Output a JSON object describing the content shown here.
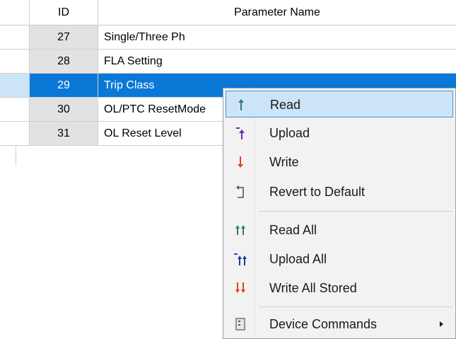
{
  "grid": {
    "columns": {
      "id": "ID",
      "name": "Parameter Name"
    },
    "rows": [
      {
        "id": "27",
        "name": "Single/Three Ph"
      },
      {
        "id": "28",
        "name": "FLA Setting"
      },
      {
        "id": "29",
        "name": "Trip Class",
        "selected": true
      },
      {
        "id": "30",
        "name": "OL/PTC ResetMode"
      },
      {
        "id": "31",
        "name": "OL Reset Level"
      }
    ]
  },
  "context_menu": {
    "items": [
      {
        "label": "Read",
        "icon": "read-arrow-up-icon",
        "highlighted": true
      },
      {
        "label": "Upload",
        "icon": "upload-arrow-icon"
      },
      {
        "label": "Write",
        "icon": "write-arrow-down-icon"
      },
      {
        "label": "Revert to Default",
        "icon": "revert-icon"
      },
      {
        "label": "Read All",
        "icon": "read-all-icon"
      },
      {
        "label": "Upload All",
        "icon": "upload-all-icon"
      },
      {
        "label": "Write All Stored",
        "icon": "write-all-icon"
      },
      {
        "label": "Device Commands",
        "icon": "device-commands-icon",
        "has_submenu": true
      }
    ]
  },
  "colors": {
    "selection": "#0a78d7",
    "menu_highlight": "#cce4f7",
    "read_icon": "#2e7d6e",
    "upload_icon": "#6a2bb8",
    "write_icon": "#e0431a"
  }
}
